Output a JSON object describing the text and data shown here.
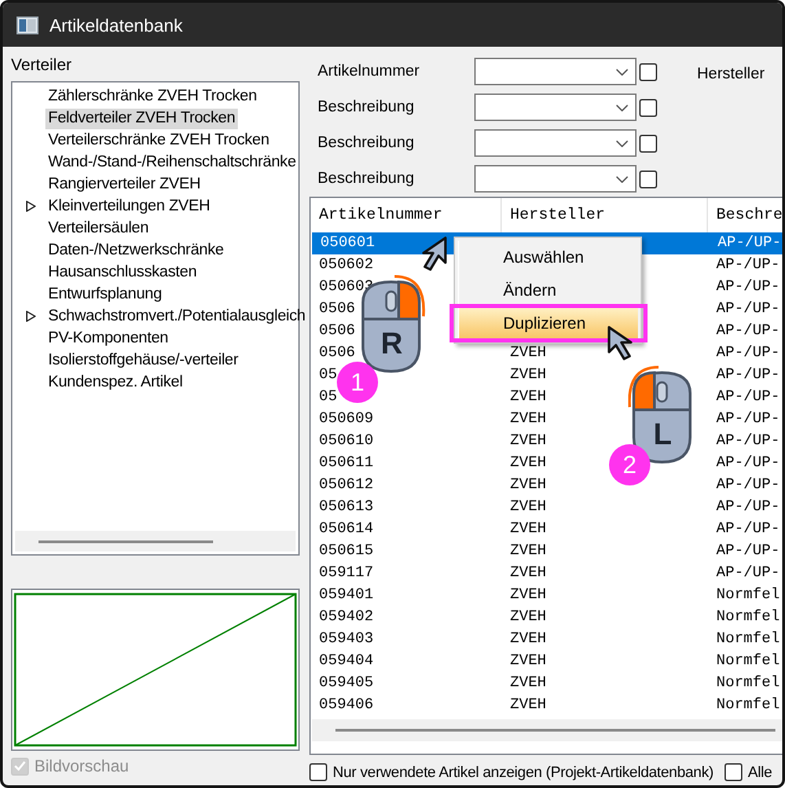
{
  "window": {
    "title": "Artikeldatenbank"
  },
  "sidebar": {
    "label": "Verteiler",
    "tree": [
      {
        "label": "Zählerschränke ZVEH Trocken",
        "selected": false,
        "has_children": false
      },
      {
        "label": "Feldverteiler ZVEH Trocken",
        "selected": true,
        "has_children": false
      },
      {
        "label": "Verteilerschränke ZVEH Trocken",
        "selected": false,
        "has_children": false
      },
      {
        "label": "Wand-/Stand-/Reihenschaltschränke",
        "selected": false,
        "has_children": false
      },
      {
        "label": "Rangierverteiler ZVEH",
        "selected": false,
        "has_children": false
      },
      {
        "label": "Kleinverteilungen ZVEH",
        "selected": false,
        "has_children": true
      },
      {
        "label": "Verteilersäulen",
        "selected": false,
        "has_children": false
      },
      {
        "label": "Daten-/Netzwerkschränke",
        "selected": false,
        "has_children": false
      },
      {
        "label": "Hausanschlusskasten",
        "selected": false,
        "has_children": false
      },
      {
        "label": "Entwurfsplanung",
        "selected": false,
        "has_children": false
      },
      {
        "label": "Schwachstromvert./Potentialausgleich",
        "selected": false,
        "has_children": true
      },
      {
        "label": "PV-Komponenten",
        "selected": false,
        "has_children": false
      },
      {
        "label": "Isolierstoffgehäuse/-verteiler",
        "selected": false,
        "has_children": false
      },
      {
        "label": "Kundenspez. Artikel",
        "selected": false,
        "has_children": false
      }
    ],
    "preview_checkbox": {
      "label": "Bildvorschau",
      "checked": true,
      "disabled": true
    }
  },
  "filters": [
    {
      "label": "Artikelnummer",
      "checked": false
    },
    {
      "label": "Beschreibung",
      "checked": false
    },
    {
      "label": "Beschreibung",
      "checked": false
    },
    {
      "label": "Beschreibung",
      "checked": false
    }
  ],
  "manufacturer_label": "Hersteller",
  "table": {
    "columns": [
      "Artikelnummer",
      "Hersteller",
      "Beschre"
    ],
    "rows": [
      {
        "id": "050601",
        "description": "AP-/UP-",
        "selected": true
      },
      {
        "id": "050602",
        "description": "AP-/UP-",
        "selected": false
      },
      {
        "id": "050603",
        "description": "AP-/UP-",
        "selected": false
      },
      {
        "id": "0506",
        "description": "AP-/UP-",
        "selected": false
      },
      {
        "id": "0506",
        "description": "AP-/UP-",
        "selected": false
      },
      {
        "id": "0506",
        "manufacturer": "ZVEH",
        "description": "AP-/UP-",
        "selected": false
      },
      {
        "id": "05",
        "manufacturer": "ZVEH",
        "description": "AP-/UP-",
        "selected": false
      },
      {
        "id": "05",
        "manufacturer": "ZVEH",
        "description": "AP-/UP-",
        "selected": false
      },
      {
        "id": "050609",
        "manufacturer": "ZVEH",
        "description": "AP-/UP-",
        "selected": false
      },
      {
        "id": "050610",
        "manufacturer": "ZVEH",
        "description": "AP-/UP-",
        "selected": false
      },
      {
        "id": "050611",
        "manufacturer": "ZVEH",
        "description": "AP-/UP-",
        "selected": false
      },
      {
        "id": "050612",
        "manufacturer": "ZVEH",
        "description": "AP-/UP-",
        "selected": false
      },
      {
        "id": "050613",
        "manufacturer": "ZVEH",
        "description": "AP-/UP-",
        "selected": false
      },
      {
        "id": "050614",
        "manufacturer": "ZVEH",
        "description": "AP-/UP-",
        "selected": false
      },
      {
        "id": "050615",
        "manufacturer": "ZVEH",
        "description": "AP-/UP-",
        "selected": false
      },
      {
        "id": "059117",
        "manufacturer": "ZVEH",
        "description": "AP-/UP-",
        "selected": false
      },
      {
        "id": "059401",
        "manufacturer": "ZVEH",
        "description": "Normfel",
        "selected": false
      },
      {
        "id": "059402",
        "manufacturer": "ZVEH",
        "description": "Normfel",
        "selected": false
      },
      {
        "id": "059403",
        "manufacturer": "ZVEH",
        "description": "Normfel",
        "selected": false
      },
      {
        "id": "059404",
        "manufacturer": "ZVEH",
        "description": "Normfel",
        "selected": false
      },
      {
        "id": "059405",
        "manufacturer": "ZVEH",
        "description": "Normfel",
        "selected": false
      },
      {
        "id": "059406",
        "manufacturer": "ZVEH",
        "description": "Normfel",
        "selected": false
      }
    ]
  },
  "context_menu": {
    "items": [
      {
        "label": "Auswählen",
        "highlighted": false
      },
      {
        "label": "Ändern",
        "highlighted": false
      },
      {
        "label": "Duplizieren",
        "highlighted": true
      }
    ]
  },
  "annotations": [
    {
      "number": "1",
      "button": "R"
    },
    {
      "number": "2",
      "button": "L"
    }
  ],
  "footer_checkboxes": [
    {
      "label": "Nur verwendete Artikel anzeigen (Projekt-Artikeldatenbank)",
      "checked": false
    },
    {
      "label": "Alle",
      "checked": false
    }
  ]
}
